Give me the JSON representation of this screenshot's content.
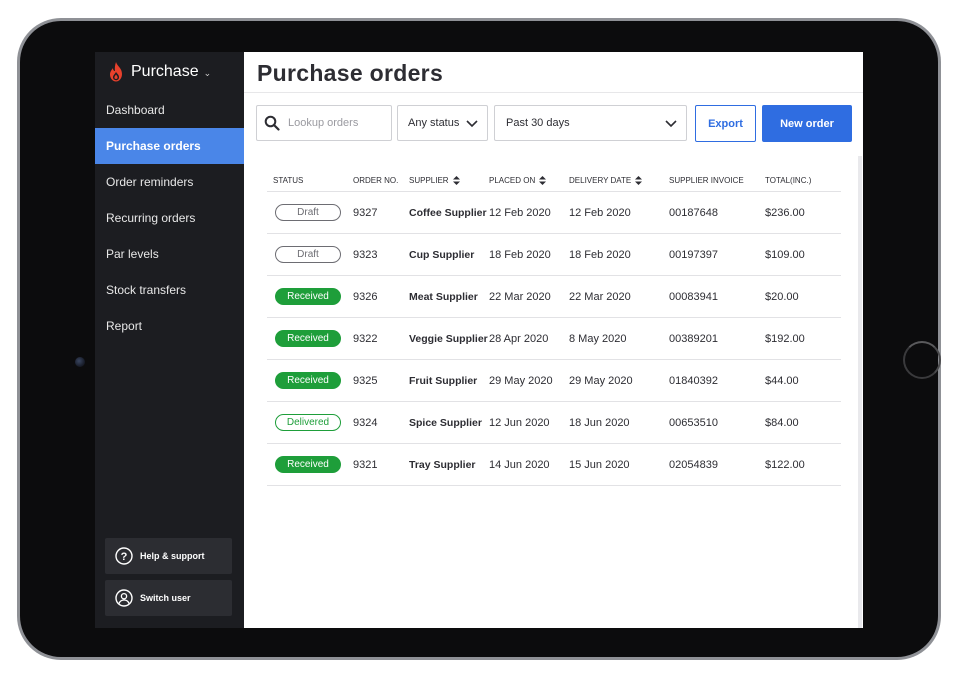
{
  "app": {
    "name": "Purchase",
    "colors": {
      "accent": "#2f6de1",
      "active_nav": "#4a86e8",
      "sidebar_bg": "#1c1d21",
      "brand_flame": "#e8412c",
      "received": "#1e9e3a",
      "draft": "#6d6d73"
    }
  },
  "sidebar": {
    "items": [
      {
        "label": "Dashboard",
        "active": false
      },
      {
        "label": "Purchase orders",
        "active": true
      },
      {
        "label": "Order reminders",
        "active": false
      },
      {
        "label": "Recurring orders",
        "active": false
      },
      {
        "label": "Par levels",
        "active": false
      },
      {
        "label": "Stock transfers",
        "active": false
      },
      {
        "label": "Report",
        "active": false
      }
    ],
    "help_label": "Help & support",
    "switch_label": "Switch user"
  },
  "main": {
    "title": "Purchase orders",
    "search": {
      "placeholder": "Lookup orders",
      "icon": "search-icon"
    },
    "status_filter": "Any status",
    "date_filter": "Past 30 days",
    "export_label": "Export",
    "new_order_label": "New order"
  },
  "table": {
    "headers": {
      "status": "STATUS",
      "order_no": "ORDER NO.",
      "supplier": "SUPPLIER",
      "placed_on": "PLACED ON",
      "delivery_date": "DELIVERY DATE",
      "supplier_invoice": "SUPPLIER INVOICE",
      "total": "TOTAL(INC.)"
    },
    "rows": [
      {
        "status": "Draft",
        "status_type": "draft",
        "order_no": "9327",
        "supplier": "Coffee Supplier",
        "placed_on": "12 Feb 2020",
        "delivery_date": "12 Feb 2020",
        "invoice": "00187648",
        "total": "$236.00"
      },
      {
        "status": "Draft",
        "status_type": "draft",
        "order_no": "9323",
        "supplier": "Cup Supplier",
        "placed_on": "18 Feb 2020",
        "delivery_date": "18 Feb 2020",
        "invoice": "00197397",
        "total": "$109.00"
      },
      {
        "status": "Received",
        "status_type": "received",
        "order_no": "9326",
        "supplier": "Meat Supplier",
        "placed_on": "22 Mar 2020",
        "delivery_date": "22 Mar 2020",
        "invoice": "00083941",
        "total": "$20.00"
      },
      {
        "status": "Received",
        "status_type": "received",
        "order_no": "9322",
        "supplier": "Veggie Supplier",
        "placed_on": "28 Apr 2020",
        "delivery_date": "8 May 2020",
        "invoice": "00389201",
        "total": "$192.00"
      },
      {
        "status": "Received",
        "status_type": "received",
        "order_no": "9325",
        "supplier": "Fruit Supplier",
        "placed_on": "29 May 2020",
        "delivery_date": "29 May 2020",
        "invoice": "01840392",
        "total": "$44.00"
      },
      {
        "status": "Delivered",
        "status_type": "delivered",
        "order_no": "9324",
        "supplier": "Spice Supplier",
        "placed_on": "12 Jun 2020",
        "delivery_date": "18 Jun 2020",
        "invoice": "00653510",
        "total": "$84.00"
      },
      {
        "status": "Received",
        "status_type": "received",
        "order_no": "9321",
        "supplier": "Tray Supplier",
        "placed_on": "14 Jun 2020",
        "delivery_date": "15 Jun 2020",
        "invoice": "02054839",
        "total": "$122.00"
      }
    ]
  }
}
